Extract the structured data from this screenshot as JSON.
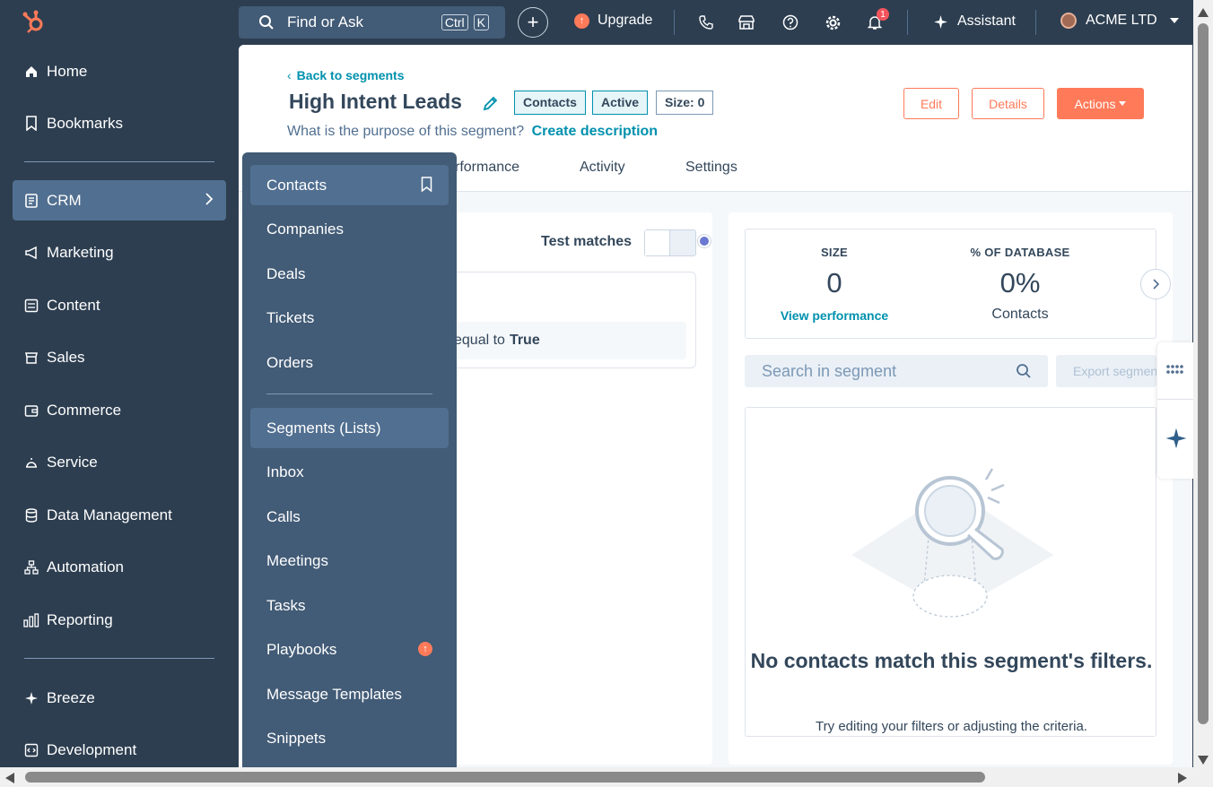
{
  "topbar": {
    "search_placeholder": "Find or Ask",
    "kbd_ctrl": "Ctrl",
    "kbd_k": "K",
    "plus_label": "+",
    "upgrade_label": "Upgrade",
    "notification_count": "1",
    "assistant_label": "Assistant",
    "account_name": "ACME LTD"
  },
  "leftnav": {
    "items": [
      {
        "label": "Home",
        "icon": "home-icon"
      },
      {
        "label": "Bookmarks",
        "icon": "bookmark-icon"
      },
      {
        "label": "CRM",
        "icon": "crm-icon"
      },
      {
        "label": "Marketing",
        "icon": "megaphone-icon"
      },
      {
        "label": "Content",
        "icon": "content-icon"
      },
      {
        "label": "Sales",
        "icon": "sales-icon"
      },
      {
        "label": "Commerce",
        "icon": "wallet-icon"
      },
      {
        "label": "Service",
        "icon": "bell-service-icon"
      },
      {
        "label": "Data Management",
        "icon": "database-icon"
      },
      {
        "label": "Automation",
        "icon": "automation-icon"
      },
      {
        "label": "Reporting",
        "icon": "reporting-icon"
      },
      {
        "label": "Breeze",
        "icon": "sparkle-icon"
      },
      {
        "label": "Development",
        "icon": "code-icon"
      }
    ]
  },
  "flyout": {
    "items": [
      {
        "label": "Contacts"
      },
      {
        "label": "Companies"
      },
      {
        "label": "Deals"
      },
      {
        "label": "Tickets"
      },
      {
        "label": "Orders"
      },
      {
        "label": "Segments (Lists)"
      },
      {
        "label": "Inbox"
      },
      {
        "label": "Calls"
      },
      {
        "label": "Meetings"
      },
      {
        "label": "Tasks"
      },
      {
        "label": "Playbooks"
      },
      {
        "label": "Message Templates"
      },
      {
        "label": "Snippets"
      }
    ]
  },
  "header": {
    "back_link": "Back to segments",
    "title": "High Intent Leads",
    "tags": [
      "Contacts",
      "Active",
      "Size: 0"
    ],
    "purpose_question": "What is the purpose of this segment?",
    "purpose_link": "Create description",
    "edit_label": "Edit",
    "details_label": "Details",
    "actions_label": "Actions",
    "tabs": [
      "rformance",
      "Activity",
      "Settings"
    ]
  },
  "filters": {
    "test_matches_label": "Test matches",
    "filter_text": "equal to",
    "filter_value": "True"
  },
  "stats": {
    "size_label": "SIZE",
    "size_value": "0",
    "size_link": "View performance",
    "db_label": "% OF DATABASE",
    "db_value": "0%",
    "db_sub": "Contacts"
  },
  "segment_search": {
    "placeholder": "Search in segment",
    "export_label": "Export segment"
  },
  "empty_state": {
    "title": "No contacts match this segment's filters.",
    "subtitle": "Try editing your filters or adjusting the criteria."
  },
  "colors": {
    "nav_bg": "#2d3e50",
    "flyout_bg": "#425b76",
    "accent_orange": "#ff7a59",
    "link_teal": "#0091ae"
  }
}
